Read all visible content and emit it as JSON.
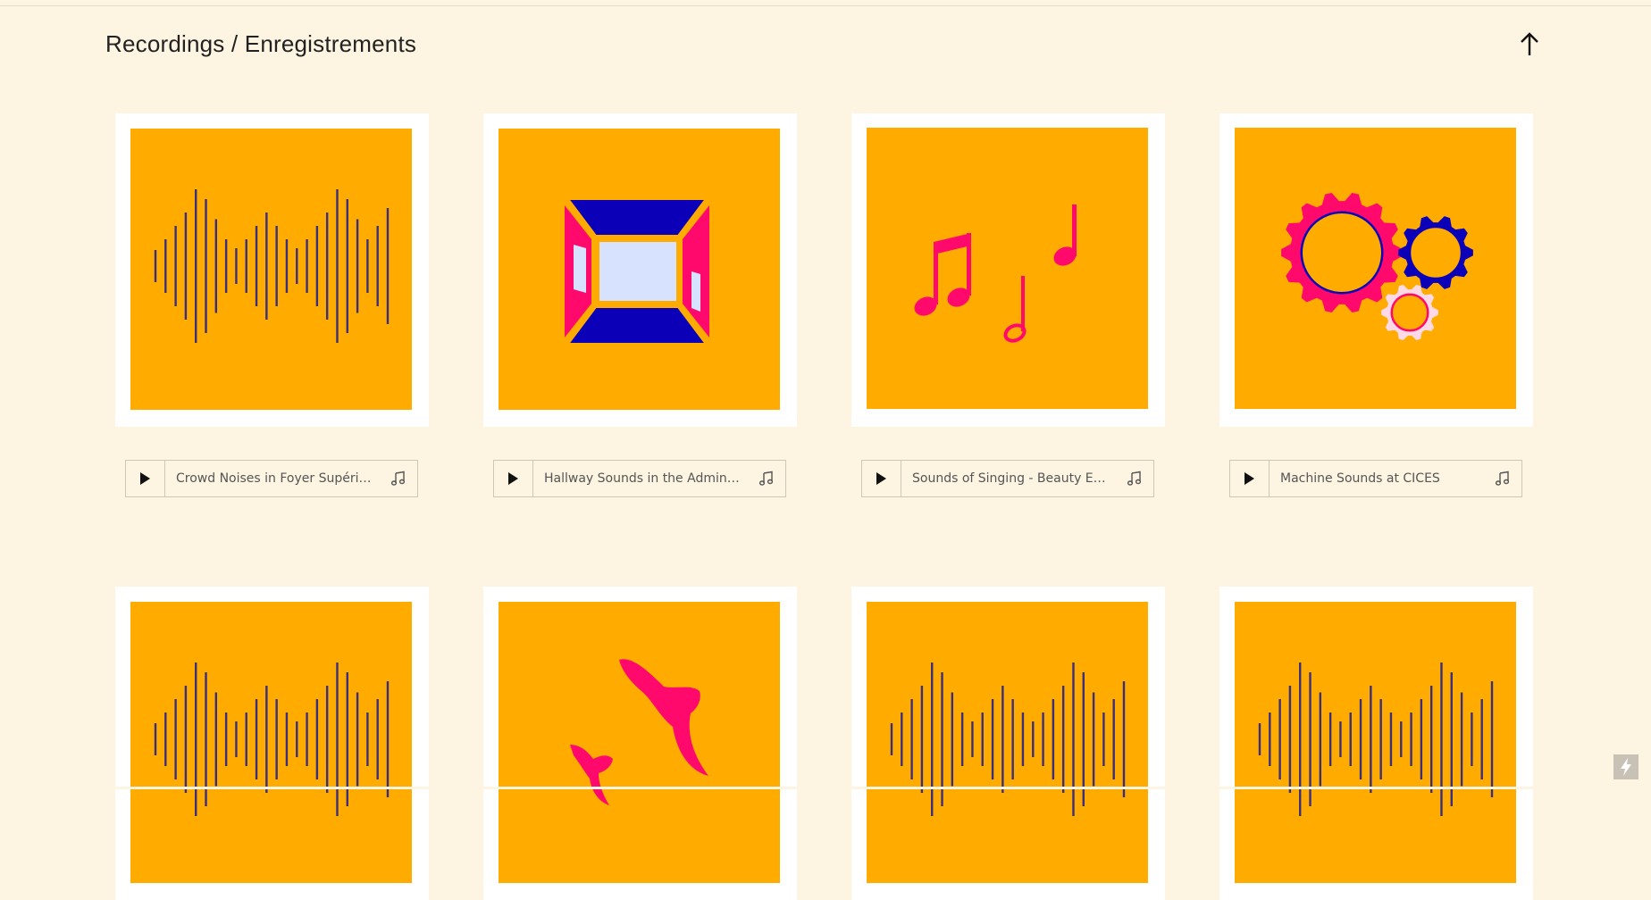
{
  "header": {
    "title": "Recordings / Enregistrements",
    "scroll_top_icon": "arrow-up-icon"
  },
  "colors": {
    "page_bg": "#fdf4e1",
    "card_bg": "#ffffff",
    "art_bg": "#ffab00",
    "accent_pink": "#ff0a6c",
    "accent_blue": "#0b00b8",
    "line_dark": "#3b2f7a"
  },
  "recordings": [
    {
      "title": "Crowd Noises in Foyer Supérieur",
      "art": "waveform"
    },
    {
      "title": "Hallway Sounds in the Administ...",
      "art": "hallway-room"
    },
    {
      "title": "Sounds of Singing - Beauty Eve...",
      "art": "music-notes"
    },
    {
      "title": "Machine Sounds at CICES",
      "art": "gears"
    },
    {
      "title": "",
      "art": "waveform"
    },
    {
      "title": "",
      "art": "birds"
    },
    {
      "title": "",
      "art": "waveform"
    },
    {
      "title": "",
      "art": "waveform"
    }
  ],
  "player": {
    "play_icon": "play-icon",
    "track_icon": "music-note-icon"
  },
  "corner_badge_icon": "lightning-icon"
}
